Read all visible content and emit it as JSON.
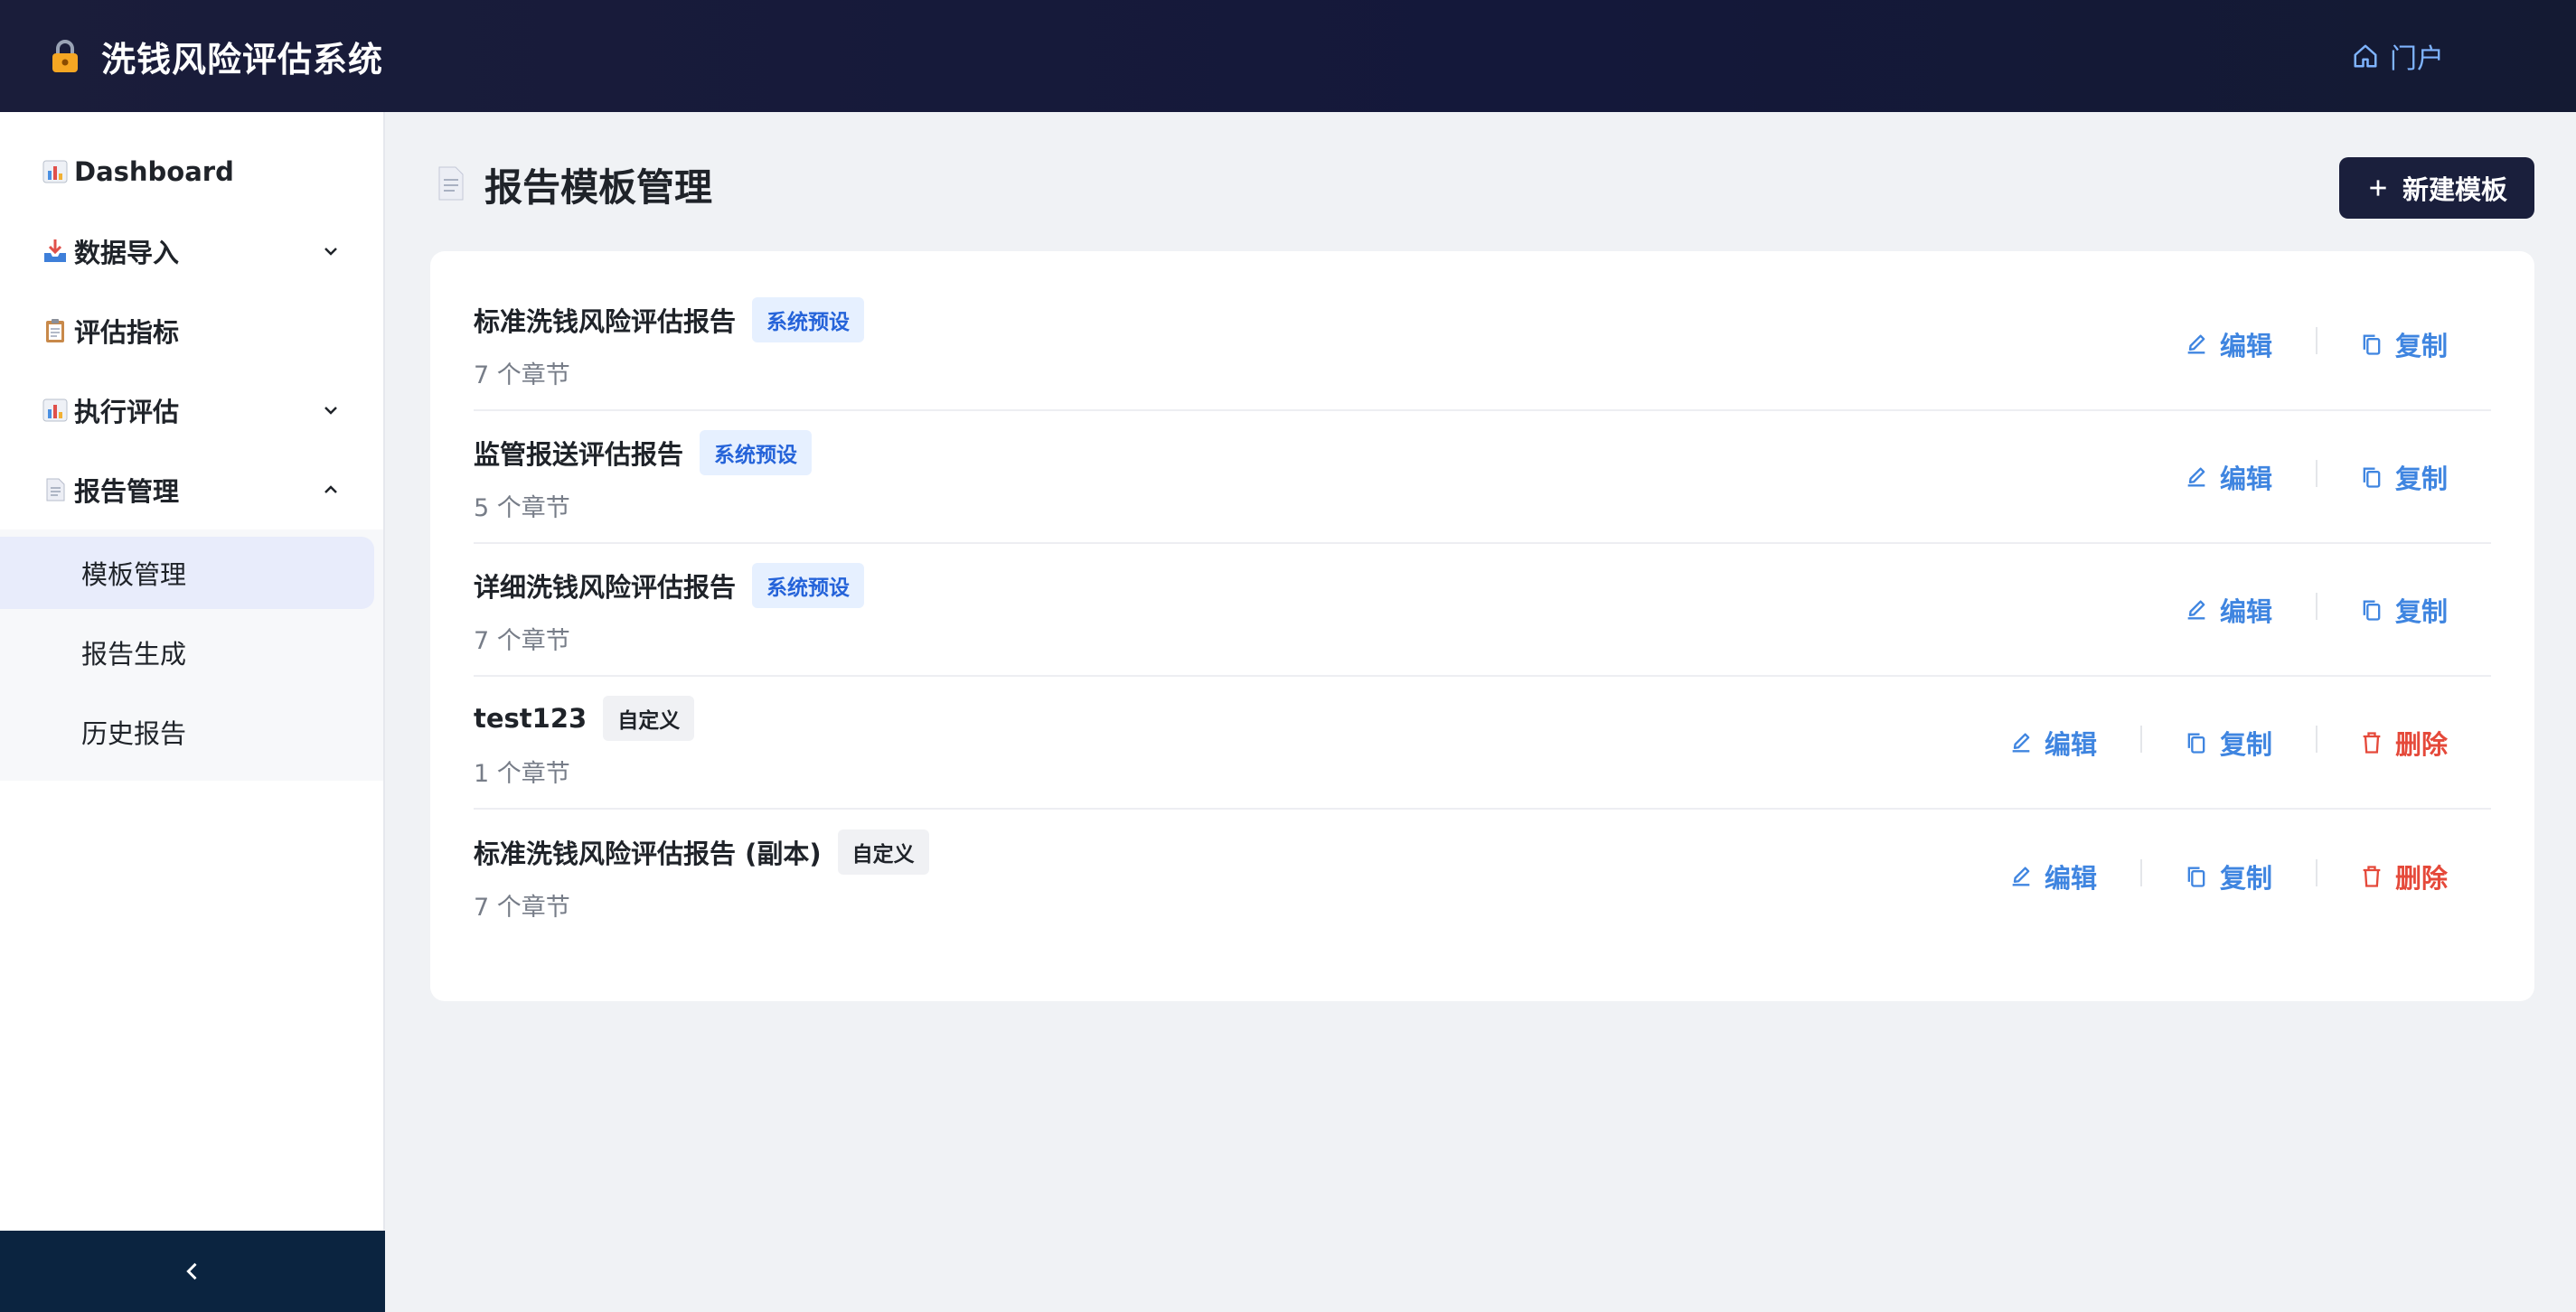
{
  "header": {
    "title": "洗钱风险评估系统",
    "portal_label": "门户"
  },
  "sidebar": {
    "items": [
      {
        "label": "Dashboard",
        "icon": "bar-chart-icon"
      },
      {
        "label": "数据导入",
        "icon": "inbox-tray-icon",
        "expandable": true,
        "expanded": false
      },
      {
        "label": "评估指标",
        "icon": "clipboard-icon"
      },
      {
        "label": "执行评估",
        "icon": "bar-chart-icon",
        "expandable": true,
        "expanded": false
      },
      {
        "label": "报告管理",
        "icon": "document-icon",
        "expandable": true,
        "expanded": true
      }
    ],
    "sub_items": [
      {
        "label": "模板管理",
        "active": true
      },
      {
        "label": "报告生成",
        "active": false
      },
      {
        "label": "历史报告",
        "active": false
      }
    ]
  },
  "main": {
    "page_title": "报告模板管理",
    "new_button": "新建模板",
    "actions": {
      "edit": "编辑",
      "copy": "复制",
      "delete": "删除"
    },
    "templates": [
      {
        "name": "标准洗钱风险评估报告",
        "tag": "系统预设",
        "tag_type": "system",
        "sections": "7 个章节",
        "deletable": false
      },
      {
        "name": "监管报送评估报告",
        "tag": "系统预设",
        "tag_type": "system",
        "sections": "5 个章节",
        "deletable": false
      },
      {
        "name": "详细洗钱风险评估报告",
        "tag": "系统预设",
        "tag_type": "system",
        "sections": "7 个章节",
        "deletable": false
      },
      {
        "name": "test123",
        "tag": "自定义",
        "tag_type": "custom",
        "sections": "1 个章节",
        "deletable": true
      },
      {
        "name": "标准洗钱风险评估报告 (副本)",
        "tag": "自定义",
        "tag_type": "custom",
        "sections": "7 个章节",
        "deletable": true
      }
    ]
  },
  "colors": {
    "header_bg": "#1a1d3a",
    "accent": "#3f85e0",
    "danger": "#e5493a",
    "primary_btn": "#1a1f3c"
  }
}
